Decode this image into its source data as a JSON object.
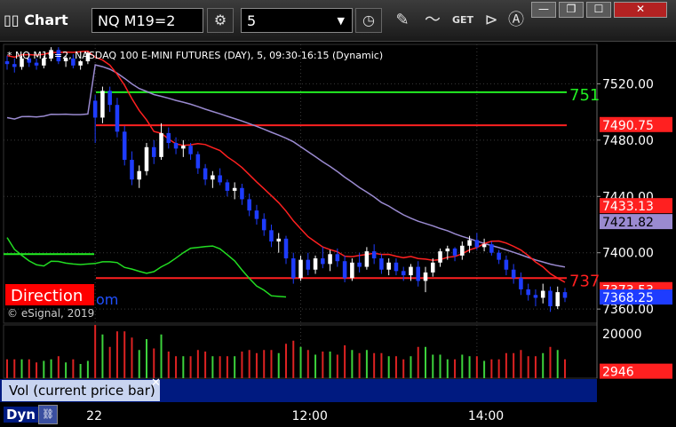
{
  "window": {
    "title": "Chart",
    "symbol": "NQ M19=2",
    "interval": "5",
    "minimize_label": "—",
    "restore_label": "❐",
    "maximize_label": "☐",
    "close_label": "✕"
  },
  "chart_header": "* NQ M19=2, NASDAQ 100 E-MINI FUTURES (DAY), 5, 09:30-16:15 (Dynamic)",
  "copyright": "© eSignal, 2019",
  "direction_label": "Direction",
  "partial_text": "om",
  "colors": {
    "up": "#ffffff",
    "down": "#1e3cff",
    "ma_red": "#ff2020",
    "ma_green": "#22dd22",
    "ma_purple": "#9a8ad0",
    "level_green": "#22ee22",
    "level_red": "#ff2020"
  },
  "chart_data": {
    "type": "candlestick",
    "price_ticks": [
      7520.0,
      7480.0,
      7440.0,
      7400.0,
      7360.0
    ],
    "price_tick_labels": [
      "7520.00",
      "7480.00",
      "7440.00",
      "7400.00",
      "7360.00"
    ],
    "time_labels": [
      "22",
      "12:00",
      "14:00"
    ],
    "price_range": [
      7350,
      7548
    ],
    "markers": [
      {
        "label": "7490.75",
        "value": 7490.75,
        "bg": "#ff2020",
        "fg": "#ffffff"
      },
      {
        "label": "7433.13",
        "value": 7433.13,
        "bg": "#ff2020",
        "fg": "#ffffff"
      },
      {
        "label": "7421.82",
        "value": 7421.82,
        "bg": "#9a8ad0",
        "fg": "#000000"
      },
      {
        "label": "7373.53",
        "value": 7373.5,
        "bg": "#ff2020",
        "fg": "#ffffff"
      },
      {
        "label": "7368.25",
        "value": 7368.25,
        "bg": "#1e3cff",
        "fg": "#ffffff"
      }
    ],
    "levels": [
      {
        "value": 7514,
        "color": "#22ee22",
        "label": "751"
      },
      {
        "value": 7490.5,
        "color": "#ff2020",
        "label": ""
      },
      {
        "value": 7382,
        "color": "#ff2020",
        "label": "737"
      }
    ],
    "candles": [
      [
        7536,
        7540,
        7530,
        7534
      ],
      [
        7534,
        7538,
        7528,
        7532
      ],
      [
        7532,
        7540,
        7530,
        7538
      ],
      [
        7538,
        7542,
        7532,
        7535
      ],
      [
        7535,
        7538,
        7530,
        7533
      ],
      [
        7533,
        7540,
        7531,
        7538
      ],
      [
        7538,
        7546,
        7536,
        7544
      ],
      [
        7544,
        7546,
        7534,
        7536
      ],
      [
        7536,
        7540,
        7532,
        7538
      ],
      [
        7538,
        7541,
        7531,
        7533
      ],
      [
        7533,
        7537,
        7530,
        7536
      ],
      [
        7536,
        7543,
        7534,
        7542
      ],
      [
        7508,
        7512,
        7478,
        7496
      ],
      [
        7496,
        7518,
        7492,
        7515
      ],
      [
        7515,
        7518,
        7500,
        7505
      ],
      [
        7505,
        7510,
        7482,
        7486
      ],
      [
        7486,
        7490,
        7462,
        7466
      ],
      [
        7466,
        7472,
        7448,
        7452
      ],
      [
        7452,
        7462,
        7446,
        7458
      ],
      [
        7458,
        7478,
        7455,
        7475
      ],
      [
        7475,
        7480,
        7463,
        7468
      ],
      [
        7468,
        7492,
        7466,
        7485
      ],
      [
        7485,
        7489,
        7474,
        7478
      ],
      [
        7478,
        7482,
        7470,
        7474
      ],
      [
        7474,
        7480,
        7468,
        7476
      ],
      [
        7476,
        7478,
        7466,
        7470
      ],
      [
        7470,
        7472,
        7456,
        7460
      ],
      [
        7460,
        7463,
        7448,
        7452
      ],
      [
        7452,
        7458,
        7446,
        7455
      ],
      [
        7455,
        7460,
        7448,
        7450
      ],
      [
        7450,
        7452,
        7440,
        7444
      ],
      [
        7444,
        7450,
        7438,
        7446
      ],
      [
        7446,
        7449,
        7434,
        7438
      ],
      [
        7438,
        7442,
        7426,
        7430
      ],
      [
        7430,
        7434,
        7420,
        7424
      ],
      [
        7424,
        7428,
        7412,
        7416
      ],
      [
        7416,
        7420,
        7404,
        7408
      ],
      [
        7408,
        7414,
        7400,
        7410
      ],
      [
        7410,
        7412,
        7392,
        7396
      ],
      [
        7396,
        7400,
        7378,
        7382
      ],
      [
        7382,
        7398,
        7380,
        7395
      ],
      [
        7395,
        7400,
        7384,
        7388
      ],
      [
        7388,
        7398,
        7385,
        7396
      ],
      [
        7396,
        7404,
        7389,
        7392
      ],
      [
        7392,
        7402,
        7387,
        7399
      ],
      [
        7399,
        7403,
        7390,
        7394
      ],
      [
        7394,
        7398,
        7379,
        7382
      ],
      [
        7382,
        7396,
        7380,
        7393
      ],
      [
        7393,
        7400,
        7386,
        7390
      ],
      [
        7390,
        7404,
        7388,
        7401
      ],
      [
        7401,
        7406,
        7392,
        7396
      ],
      [
        7396,
        7399,
        7385,
        7388
      ],
      [
        7388,
        7396,
        7384,
        7393
      ],
      [
        7393,
        7396,
        7384,
        7387
      ],
      [
        7387,
        7390,
        7380,
        7384
      ],
      [
        7384,
        7392,
        7380,
        7390
      ],
      [
        7390,
        7394,
        7376,
        7380
      ],
      [
        7380,
        7390,
        7372,
        7386
      ],
      [
        7386,
        7396,
        7383,
        7393
      ],
      [
        7393,
        7403,
        7390,
        7401
      ],
      [
        7401,
        7405,
        7395,
        7403
      ],
      [
        7403,
        7404,
        7394,
        7398
      ],
      [
        7398,
        7408,
        7395,
        7405
      ],
      [
        7405,
        7412,
        7400,
        7409
      ],
      [
        7409,
        7414,
        7402,
        7404
      ],
      [
        7404,
        7410,
        7401,
        7406
      ],
      [
        7406,
        7408,
        7398,
        7400
      ],
      [
        7400,
        7402,
        7392,
        7395
      ],
      [
        7395,
        7398,
        7384,
        7388
      ],
      [
        7388,
        7392,
        7378,
        7382
      ],
      [
        7382,
        7386,
        7370,
        7374
      ],
      [
        7374,
        7378,
        7366,
        7370
      ],
      [
        7370,
        7374,
        7362,
        7368
      ],
      [
        7368,
        7378,
        7364,
        7373
      ],
      [
        7373,
        7376,
        7358,
        7362
      ],
      [
        7362,
        7376,
        7360,
        7372
      ],
      [
        7372,
        7375,
        7365,
        7368
      ]
    ],
    "volume_axis": {
      "tick_label": "20000",
      "tick_value": 20000,
      "max": 24000
    },
    "volume_marker": {
      "label": "2946",
      "value": 2946,
      "bg": "#ff2020",
      "fg": "#ffffff"
    },
    "volume_series_name": "Vol (current price bar)"
  }
}
